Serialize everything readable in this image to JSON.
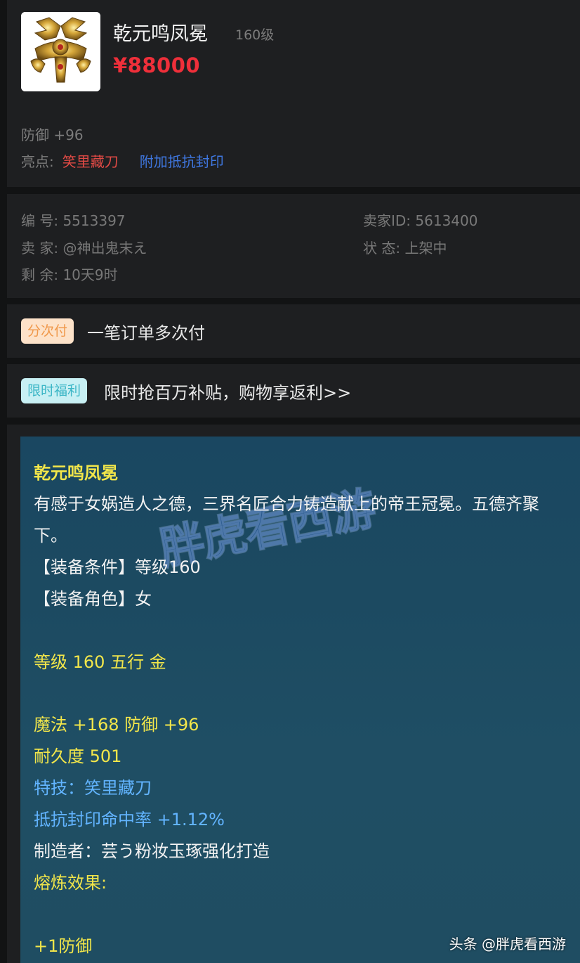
{
  "item": {
    "name": "乾元鸣凤冕",
    "level": "160级",
    "price": "¥88000",
    "defense_stat": "防御 +96",
    "highlight_label": "亮点:",
    "highlights": [
      "笑里藏刀",
      "附加抵抗封印"
    ]
  },
  "listing": {
    "number": "编 号: 5513397",
    "seller_id": "卖家ID: 5613400",
    "seller": "卖 家: @神出鬼末え",
    "status": "状 态: 上架中",
    "remaining": "剩 余: 10天9时"
  },
  "installment": {
    "badge": "分次付",
    "text": "一笔订单多次付"
  },
  "promo": {
    "badge": "限时福利",
    "text": "限时抢百万补贴，购物享返利>>"
  },
  "tooltip": {
    "watermark": "胖虎看西游",
    "title": "乾元鸣凤冕",
    "desc_line1": "有感于女娲造人之德，三界名匠合力铸造献上的帝王冠冕。五德齐聚",
    "desc_line2": "下。",
    "req_level": "【装备条件】等级160",
    "req_role": "【装备角色】女",
    "level_element": "等级 160 五行 金",
    "stats_line": "魔法 +168 防御 +96",
    "durability": "耐久度 501",
    "skill": "特技：笑里藏刀",
    "seal_resist": "抵抗封印命中率 +1.12%",
    "maker": "制造者：芸う粉妆玉琢强化打造",
    "smelt_label": "熔炼效果:",
    "smelt_value": "+1防御"
  },
  "footer": {
    "source": "头条 @胖虎看西游"
  },
  "colors": {
    "price_red": "#ef2f3a",
    "highlight_red": "#e04a45",
    "highlight_blue": "#3f77e0",
    "tooltip_yellow": "#f2e64a",
    "tooltip_blue": "#62b4ff"
  }
}
